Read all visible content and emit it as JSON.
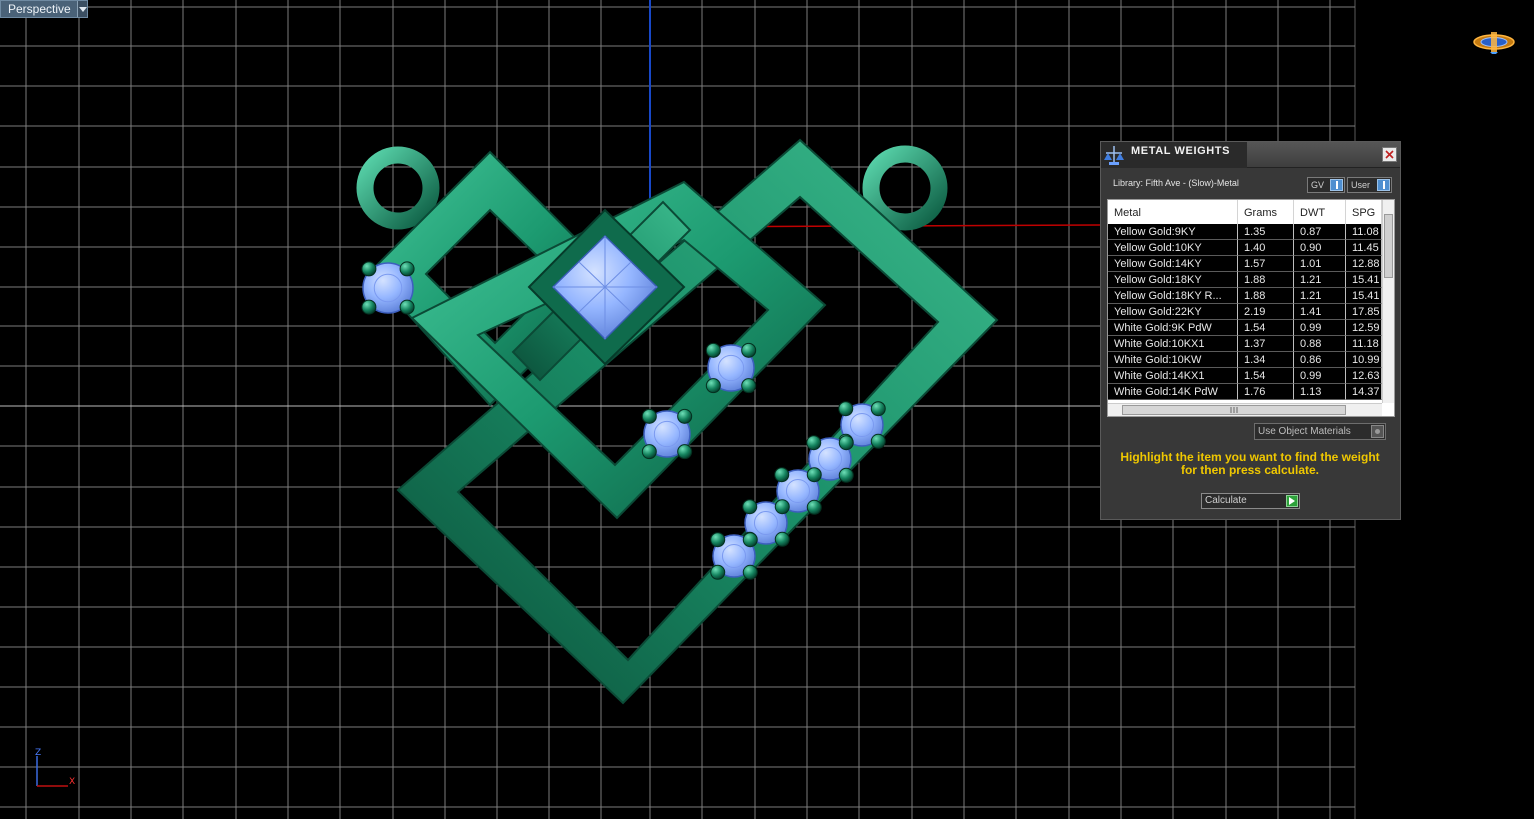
{
  "viewport": {
    "label": "Perspective"
  },
  "axes": {
    "z": "Z",
    "x": "X"
  },
  "colors": {
    "grid": "#8a8a8a",
    "axis_x": "#c00000",
    "axis_y": "#1848c8",
    "metal": "#1f9a73",
    "gem": "#8fb4ff",
    "panel_bg": "#383838",
    "hint": "#f0c800"
  },
  "metal_weights": {
    "title": "METAL WEIGHTS",
    "library": "Library: Fifth Ave - (Slow)-Metal",
    "btn_gv": "GV",
    "btn_user": "User",
    "columns": [
      "Metal",
      "Grams",
      "DWT",
      "SPG"
    ],
    "rows": [
      [
        "Yellow Gold:9KY",
        "1.35",
        "0.87",
        "11.08"
      ],
      [
        "Yellow Gold:10KY",
        "1.40",
        "0.90",
        "11.45"
      ],
      [
        "Yellow Gold:14KY",
        "1.57",
        "1.01",
        "12.88"
      ],
      [
        "Yellow Gold:18KY",
        "1.88",
        "1.21",
        "15.41"
      ],
      [
        "Yellow Gold:18KY R...",
        "1.88",
        "1.21",
        "15.41"
      ],
      [
        "Yellow Gold:22KY",
        "2.19",
        "1.41",
        "17.85"
      ],
      [
        "White Gold:9K PdW",
        "1.54",
        "0.99",
        "12.59"
      ],
      [
        "White Gold:10KX1",
        "1.37",
        "0.88",
        "11.18"
      ],
      [
        "White Gold:10KW",
        "1.34",
        "0.86",
        "10.99"
      ],
      [
        "White Gold:14KX1",
        "1.54",
        "0.99",
        "12.63"
      ],
      [
        "White Gold:14K PdW",
        "1.76",
        "1.13",
        "14.37"
      ]
    ],
    "use_object_materials": "Use Object Materials",
    "hint": "Highlight the item you want to find the weight for then press calculate.",
    "calculate": "Calculate"
  }
}
